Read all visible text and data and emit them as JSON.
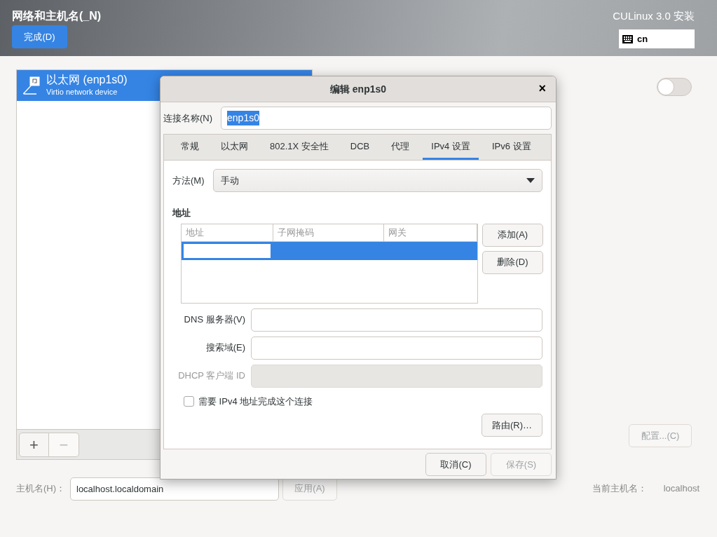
{
  "header": {
    "title": "网络和主机名(_N)",
    "done_button": "完成(D)",
    "product": "CULinux 3.0 安装",
    "keyboard_layout": "cn"
  },
  "devices": [
    {
      "name": "以太网 (enp1s0)",
      "description": "Virtio network device",
      "selected": true
    }
  ],
  "device_toolbar": [
    {
      "label": "+",
      "disabled": false
    },
    {
      "label": "−",
      "disabled": true
    }
  ],
  "connection_switch": {
    "on": false
  },
  "configure_button": {
    "label": "配置...(C)",
    "disabled": true
  },
  "hostname": {
    "label": "主机名(H)：",
    "value": "localhost.localdomain",
    "apply_button": "应用(A)",
    "apply_disabled": true,
    "current_label": "当前主机名：",
    "current_value": "localhost"
  },
  "dialog": {
    "title": "编辑 enp1s0",
    "close": "×",
    "connection_name_label": "连接名称(N)",
    "connection_name": "enp1s0",
    "connection_name_selected": true,
    "tabs": [
      {
        "label": "常规",
        "selected": false
      },
      {
        "label": "以太网",
        "selected": false
      },
      {
        "label": "802.1X 安全性",
        "selected": false
      },
      {
        "label": "DCB",
        "selected": false
      },
      {
        "label": "代理",
        "selected": false
      },
      {
        "label": "IPv4 设置",
        "selected": true
      },
      {
        "label": "IPv6 设置",
        "selected": false
      }
    ],
    "method_label": "方法(M)",
    "method": "手动",
    "address_heading": "地址",
    "address_columns": [
      "地址",
      "子网掩码",
      "网关"
    ],
    "address_rows": [
      {
        "selected": true,
        "editing": true
      }
    ],
    "address_buttons": [
      {
        "label": "添加(A)"
      },
      {
        "label": "删除(D)"
      }
    ],
    "fields": [
      {
        "label": "DNS 服务器(V)",
        "disabled": false
      },
      {
        "label": "搜索域(E)",
        "disabled": false
      },
      {
        "label": "DHCP 客户端 ID",
        "disabled": true
      }
    ],
    "checkbox": {
      "label": "需要 IPv4 地址完成这个连接",
      "checked": false
    },
    "routes_button": "路由(R)…",
    "footer_buttons": [
      {
        "label": "取消(C)",
        "disabled": false
      },
      {
        "label": "保存(S)",
        "disabled": true
      }
    ]
  }
}
